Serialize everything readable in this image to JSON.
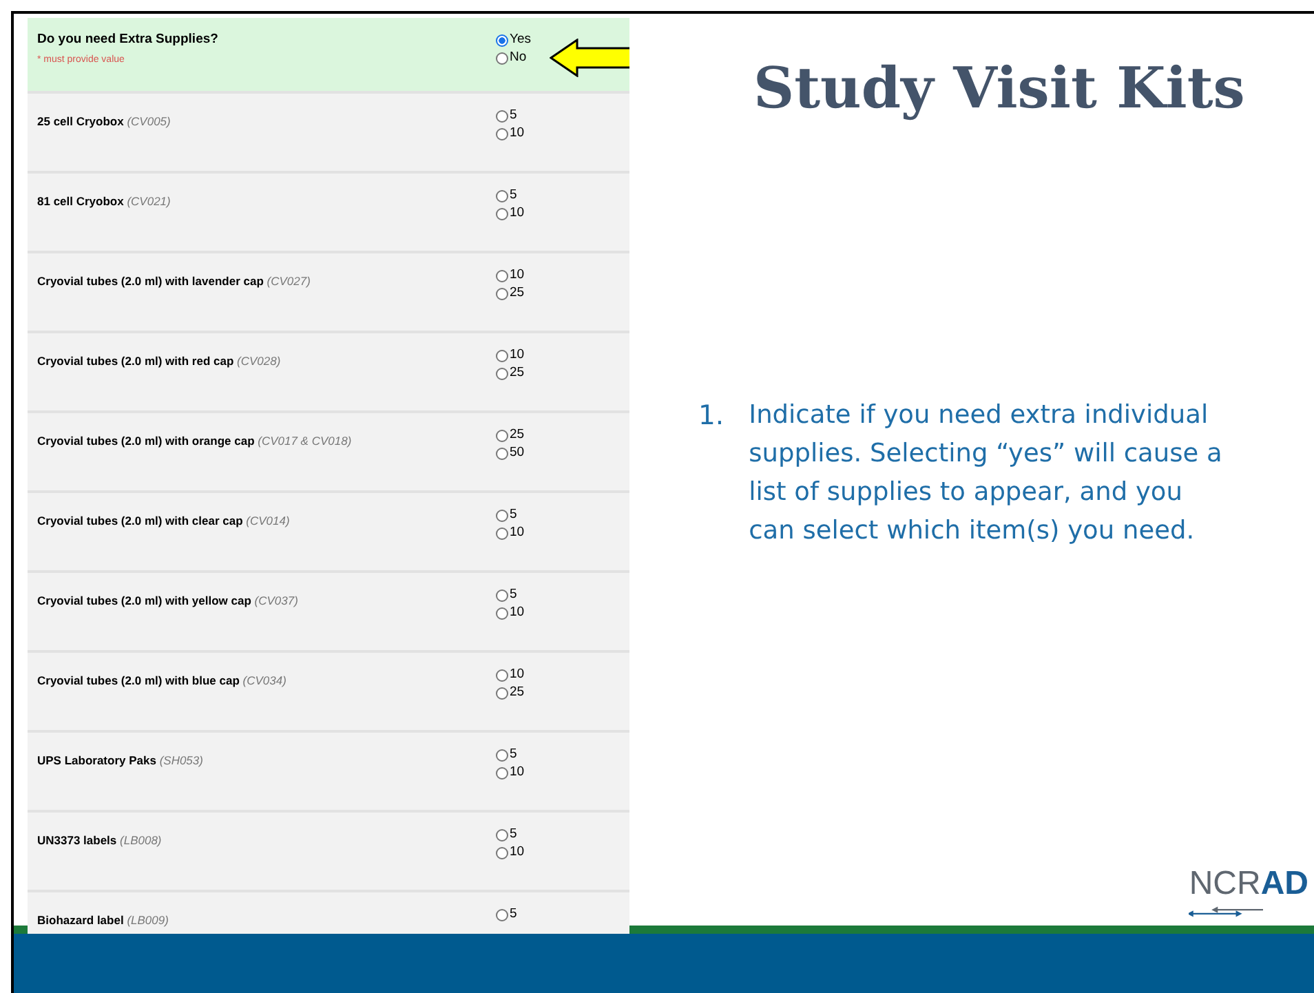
{
  "question": {
    "label": "Do you need Extra Supplies?",
    "note": "* must provide value",
    "options": [
      {
        "label": "Yes",
        "selected": true
      },
      {
        "label": "No",
        "selected": false
      }
    ]
  },
  "items": [
    {
      "label": "25 cell Cryobox *(CV005)*",
      "options": [
        {
          "label": "5",
          "selected": false
        },
        {
          "label": "10",
          "selected": false
        }
      ]
    },
    {
      "label": "81 cell Cryobox *(CV021)*",
      "options": [
        {
          "label": "5",
          "selected": false
        },
        {
          "label": "10",
          "selected": false
        }
      ]
    },
    {
      "label": "Cryovial tubes (2.0 ml) with lavender cap *(CV027)*",
      "options": [
        {
          "label": "10",
          "selected": false
        },
        {
          "label": "25",
          "selected": false
        }
      ]
    },
    {
      "label": "Cryovial tubes (2.0 ml) with red cap *(CV028)*",
      "options": [
        {
          "label": "10",
          "selected": false
        },
        {
          "label": "25",
          "selected": false
        }
      ]
    },
    {
      "label": "Cryovial tubes (2.0 ml) with orange cap *(CV017 & CV018)*",
      "options": [
        {
          "label": "25",
          "selected": false
        },
        {
          "label": "50",
          "selected": false
        }
      ]
    },
    {
      "label": "Cryovial tubes (2.0 ml) with clear cap *(CV014)*",
      "options": [
        {
          "label": "5",
          "selected": false
        },
        {
          "label": "10",
          "selected": false
        }
      ]
    },
    {
      "label": "Cryovial tubes (2.0 ml) with yellow cap *(CV037)*",
      "options": [
        {
          "label": "5",
          "selected": false
        },
        {
          "label": "10",
          "selected": false
        }
      ]
    },
    {
      "label": "Cryovial tubes (2.0 ml) with blue cap *(CV034)*",
      "options": [
        {
          "label": "10",
          "selected": false
        },
        {
          "label": "25",
          "selected": false
        }
      ]
    },
    {
      "label": "UPS Laboratory Paks *(SH053)*",
      "options": [
        {
          "label": "5",
          "selected": false
        },
        {
          "label": "10",
          "selected": false
        }
      ]
    },
    {
      "label": "UN3373 labels *(LB008)*",
      "options": [
        {
          "label": "5",
          "selected": false
        },
        {
          "label": "10",
          "selected": false
        }
      ]
    },
    {
      "label": "Biohazard label *(LB009)*",
      "options": [
        {
          "label": "5",
          "selected": false
        }
      ]
    }
  ],
  "title": "Study Visit Kits",
  "instructions": [
    {
      "number": "1.",
      "text": "Indicate if you need extra individual supplies. Selecting “yes” will cause a list of supplies to appear, and you can select which item(s) you need."
    }
  ],
  "logo": {
    "light": "NCR",
    "bold": "AD"
  }
}
